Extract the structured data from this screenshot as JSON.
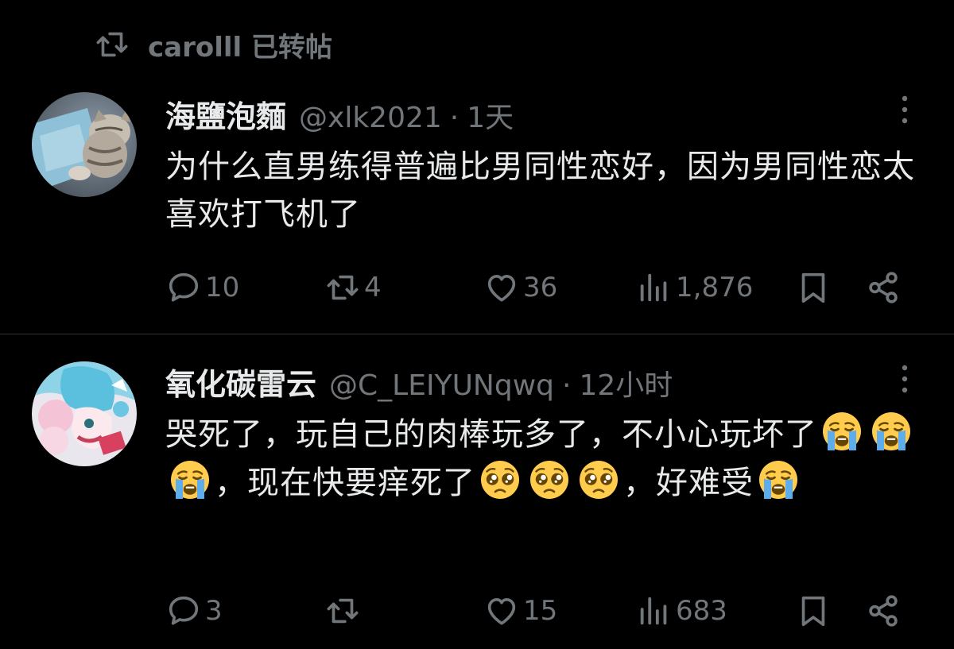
{
  "repost_banner": {
    "icon": "retweet-icon",
    "text": "carolll 已转帖"
  },
  "colors": {
    "background": "#000000",
    "primary_text": "#e7e9ea",
    "secondary_text": "#71767b",
    "divider": "#2f3336"
  },
  "tweets": [
    {
      "display_name": "海鹽泡麵",
      "handle": "@xlk2021",
      "separator": "·",
      "time": "1天",
      "text": "为什么直男练得普遍比男同性恋好，因为男同性恋太喜欢打飞机了",
      "avatar": "cat-avatar",
      "actions": {
        "replies": "10",
        "retweets": "4",
        "likes": "36",
        "views": "1,876"
      }
    },
    {
      "display_name": "氧化碳雷云",
      "handle": "@C_LEIYUNqwq",
      "separator": "·",
      "time": "12小时",
      "text_parts": {
        "p1": "哭死了，玩自己的肉棒玩多了，不小心玩坏了",
        "p2": "，现在快要痒死了",
        "p3": "，好难受"
      },
      "emojis": {
        "crying": "loudly-crying-face-emoji",
        "pleading": "pleading-face-emoji"
      },
      "avatar": "anime-avatar",
      "actions": {
        "replies": "3",
        "retweets": "",
        "likes": "15",
        "views": "683"
      }
    }
  ]
}
